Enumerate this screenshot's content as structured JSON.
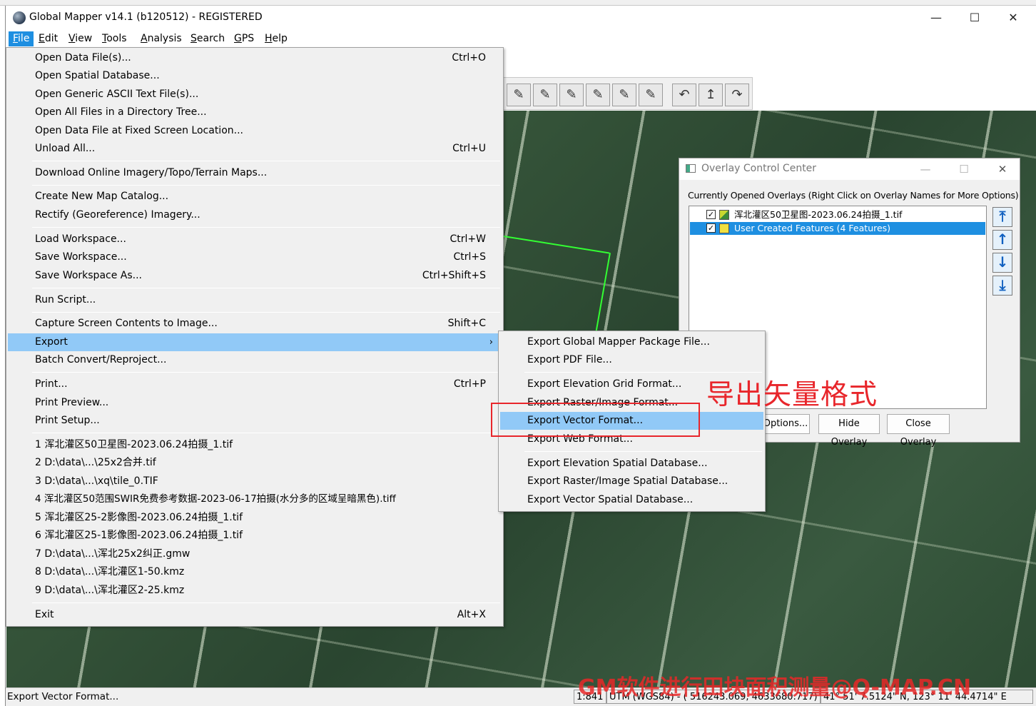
{
  "window": {
    "title": "Global Mapper v14.1 (b120512) - REGISTERED",
    "minimize": "—",
    "maximize": "☐",
    "close": "✕"
  },
  "menubar": [
    "File",
    "Edit",
    "View",
    "Tools",
    "Analysis",
    "Search",
    "GPS",
    "Help"
  ],
  "file_menu": {
    "groups": [
      [
        {
          "label": "Open Data File(s)...",
          "shortcut": "Ctrl+O"
        },
        {
          "label": "Open Spatial Database...",
          "shortcut": ""
        },
        {
          "label": "Open Generic ASCII Text File(s)...",
          "shortcut": ""
        },
        {
          "label": "Open All Files in a Directory Tree...",
          "shortcut": ""
        },
        {
          "label": "Open Data File at Fixed Screen Location...",
          "shortcut": ""
        },
        {
          "label": "Unload All...",
          "shortcut": "Ctrl+U"
        }
      ],
      [
        {
          "label": "Download Online Imagery/Topo/Terrain Maps...",
          "shortcut": ""
        }
      ],
      [
        {
          "label": "Create New Map Catalog...",
          "shortcut": ""
        },
        {
          "label": "Rectify (Georeference) Imagery...",
          "shortcut": ""
        }
      ],
      [
        {
          "label": "Load Workspace...",
          "shortcut": "Ctrl+W"
        },
        {
          "label": "Save Workspace...",
          "shortcut": "Ctrl+S"
        },
        {
          "label": "Save Workspace As...",
          "shortcut": "Ctrl+Shift+S"
        }
      ],
      [
        {
          "label": "Run Script...",
          "shortcut": ""
        }
      ],
      [
        {
          "label": "Capture Screen Contents to Image...",
          "shortcut": "Shift+C"
        },
        {
          "label": "Export",
          "shortcut": "",
          "submenu": true,
          "highlighted": true
        },
        {
          "label": "Batch Convert/Reproject...",
          "shortcut": ""
        }
      ],
      [
        {
          "label": "Print...",
          "shortcut": "Ctrl+P"
        },
        {
          "label": "Print Preview...",
          "shortcut": ""
        },
        {
          "label": "Print Setup...",
          "shortcut": ""
        }
      ],
      [
        {
          "label": "1 浑北灌区50卫星图-2023.06.24拍摄_1.tif",
          "shortcut": ""
        },
        {
          "label": "2 D:\\data\\...\\25x2合并.tif",
          "shortcut": ""
        },
        {
          "label": "3 D:\\data\\...\\xq\\tile_0.TIF",
          "shortcut": ""
        },
        {
          "label": "4 浑北灌区50范围SWIR免费参考数据-2023-06-17拍摄(水分多的区域呈暗黑色).tiff",
          "shortcut": ""
        },
        {
          "label": "5 浑北灌区25-2影像图-2023.06.24拍摄_1.tif",
          "shortcut": ""
        },
        {
          "label": "6 浑北灌区25-1影像图-2023.06.24拍摄_1.tif",
          "shortcut": ""
        },
        {
          "label": "7 D:\\data\\...\\浑北25x2纠正.gmw",
          "shortcut": ""
        },
        {
          "label": "8 D:\\data\\...\\浑北灌区1-50.kmz",
          "shortcut": ""
        },
        {
          "label": "9 D:\\data\\...\\浑北灌区2-25.kmz",
          "shortcut": ""
        }
      ],
      [
        {
          "label": "Exit",
          "shortcut": "Alt+X"
        }
      ]
    ],
    "submenu_chevron": "›"
  },
  "export_menu": {
    "groups": [
      [
        {
          "label": "Export Global Mapper Package File..."
        },
        {
          "label": "Export PDF File..."
        }
      ],
      [
        {
          "label": "Export Elevation Grid Format..."
        },
        {
          "label": "Export Raster/Image Format..."
        },
        {
          "label": "Export Vector Format...",
          "highlighted": true
        },
        {
          "label": "Export Web Format..."
        }
      ],
      [
        {
          "label": "Export Elevation Spatial Database..."
        },
        {
          "label": "Export Raster/Image Spatial Database..."
        },
        {
          "label": "Export Vector Spatial Database..."
        }
      ]
    ]
  },
  "overlay_control_center": {
    "title": "Overlay Control Center",
    "caption": "Currently Opened Overlays (Right Click on Overlay Names for More Options)",
    "overlays": [
      {
        "name": "浑北灌区50卫星图-2023.06.24拍摄_1.tif",
        "checked": true,
        "selected": false
      },
      {
        "name": "User Created Features (4 Features)",
        "checked": true,
        "selected": true
      }
    ],
    "buttons": [
      "Options...",
      "Hide Overlay",
      "Close Overlay"
    ],
    "checkmark": "✓",
    "move_arrows": [
      "⤒",
      "↑",
      "↓",
      "⤓"
    ],
    "minimize": "—",
    "maximize": "☐",
    "close": "✕"
  },
  "toolbar": {
    "glyphs": [
      "✎",
      "✎",
      "✎",
      "✎",
      "✎",
      "✎",
      "↶",
      "↥",
      "↷"
    ]
  },
  "annotation": {
    "note": "导出矢量格式",
    "watermark": "GM软件进行田块面积测量@Q-MAP.CN"
  },
  "statusbar": {
    "message": "Export Vector Format...",
    "scale": "1:841",
    "projection": "UTM (WGS84) - ( 516243.069, 4633680.717)",
    "latlon": "41° 51' 7.5124\" N, 123° 11' 44.4714\" E"
  },
  "colors": {
    "menu_highlight": "#91c9f7",
    "selection": "#1e8fe1",
    "annotation_red": "#e8262b",
    "feature_green": "#33ff33"
  }
}
